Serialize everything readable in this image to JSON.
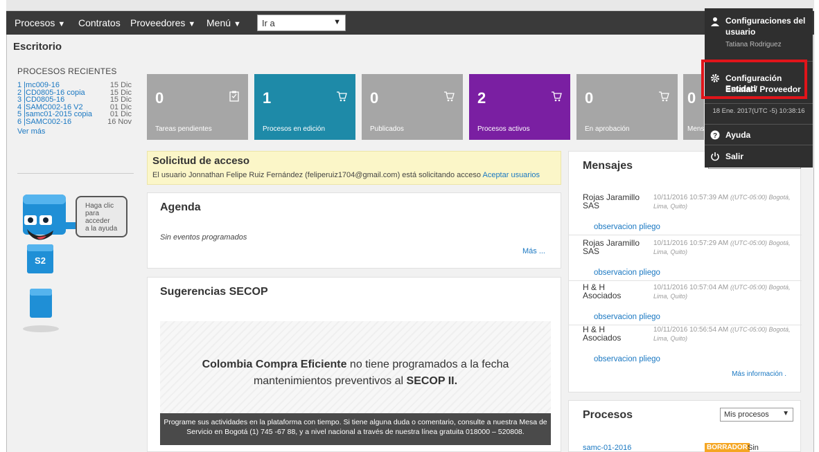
{
  "nav": {
    "items": [
      {
        "label": "Procesos",
        "caret": true
      },
      {
        "label": "Contratos",
        "caret": false
      },
      {
        "label": "Proveedores",
        "caret": true
      },
      {
        "label": "Menú",
        "caret": true
      }
    ],
    "goto_value": "Ir a"
  },
  "page": {
    "title": "Escritorio"
  },
  "recent": {
    "heading": "PROCESOS RECIENTES",
    "items": [
      {
        "name": "1 |mc009-16",
        "date": "15 Dic"
      },
      {
        "name": "2 |CD0805-16 copia",
        "date": "15 Dic"
      },
      {
        "name": "3 |CD0805-16",
        "date": "15 Dic"
      },
      {
        "name": "4 |SAMC002-16 V2",
        "date": "01 Dic"
      },
      {
        "name": "5 |samc01-2015 copia",
        "date": "01 Dic"
      },
      {
        "name": "6 |SAMC002-16",
        "date": "16 Nov"
      }
    ],
    "more": "Ver más"
  },
  "mascot": {
    "bubble_line1": "Haga clic",
    "bubble_line2": "para acceder",
    "bubble_line3": "a la ayuda",
    "badge": "S2"
  },
  "tiles": [
    {
      "count": "0",
      "label": "Tareas pendientes",
      "color": "#a6a6a6",
      "icon": "clipboard-check-icon"
    },
    {
      "count": "1",
      "label": "Procesos en edición",
      "color": "#1e8aa8",
      "icon": "cart-icon"
    },
    {
      "count": "0",
      "label": "Publicados",
      "color": "#a6a6a6",
      "icon": "cart-icon"
    },
    {
      "count": "2",
      "label": "Procesos activos",
      "color": "#7a1fa2",
      "icon": "cart-icon"
    },
    {
      "count": "0",
      "label": "En aprobación",
      "color": "#a6a6a6",
      "icon": "cart-icon"
    },
    {
      "count": "0",
      "label": "Mens",
      "color": "#a6a6a6",
      "icon": "cart-icon"
    }
  ],
  "access": {
    "title": "Solicitud de acceso",
    "message": "El usuario Jonnathan Felipe Ruiz Fernández (feliperuiz1704@gmail.com) está solicitando acceso",
    "link": "Aceptar usuarios"
  },
  "agenda": {
    "title": "Agenda",
    "empty": "Sin eventos programados",
    "more": "Más ..."
  },
  "sugerencias": {
    "title": "Sugerencias SECOP",
    "line1_bold": "Colombia Compra Eficiente",
    "line1_rest": " no tiene programados a la fecha",
    "line2_pre": "mantenimientos preventivos al ",
    "line2_bold": "SECOP II.",
    "footer_line1": "Programe sus actividades en la plataforma con tiempo. Si tiene alguna duda o comentario, consulte a nuestra Mesa de",
    "footer_line2": "Servicio en Bogotá (1) 745 -67 88, y a nivel nacional a través de nuestra línea gratuita 018000 – 520808."
  },
  "messages": {
    "title": "Mensajes",
    "items": [
      {
        "from": "Rojas Jaramillo SAS",
        "time": "10/11/2016 10:57:39 AM",
        "tz": "((UTC-05:00) Bogotá, Lima, Quito)",
        "subject": "observacion pliego"
      },
      {
        "from": "Rojas Jaramillo SAS",
        "time": "10/11/2016 10:57:29 AM",
        "tz": "((UTC-05:00) Bogotá, Lima, Quito)",
        "subject": "observacion pliego"
      },
      {
        "from": "H & H Asociados",
        "time": "10/11/2016 10:57:04 AM",
        "tz": "((UTC-05:00) Bogotá, Lima, Quito)",
        "subject": "observacion pliego"
      },
      {
        "from": "H & H Asociados",
        "time": "10/11/2016 10:56:54 AM",
        "tz": "((UTC-05:00) Bogotá, Lima, Quito)",
        "subject": "observacion pliego"
      }
    ],
    "more": "Más información ."
  },
  "procesos": {
    "title": "Procesos",
    "filter": "Mis procesos",
    "row": {
      "name": "samc-01-2016",
      "status": "BORRADOR",
      "doc": "Sin documento"
    }
  },
  "user_menu": {
    "config_user_line1": "Configuraciones del",
    "config_user_line2": "usuario",
    "user_name": "Tatiana Rodriguez",
    "config_entity_line1": "Configuración Entidad",
    "config_entity_line2": "Estatal / Proveedor",
    "datetime": "18 Ene. 2017(UTC -5) 10:38:16",
    "help": "Ayuda",
    "logout": "Salir"
  }
}
